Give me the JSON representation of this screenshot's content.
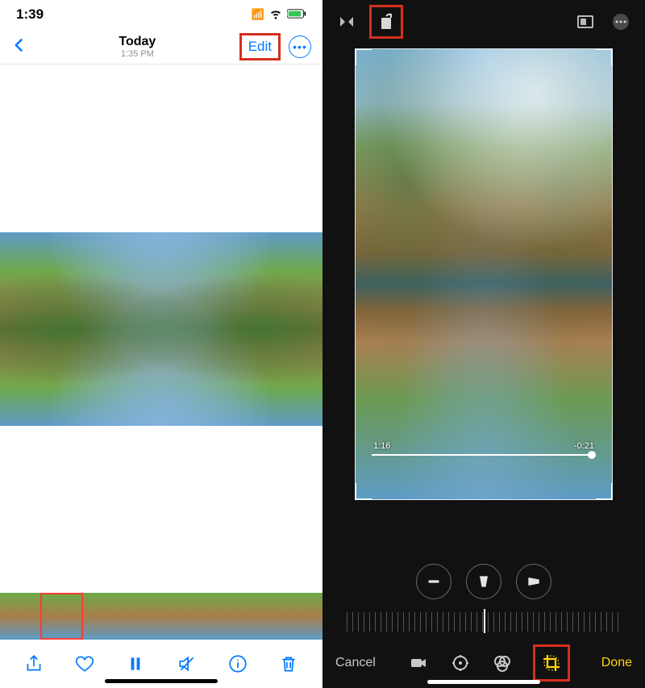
{
  "status": {
    "time": "1:39"
  },
  "nav": {
    "title": "Today",
    "subtitle": "1:35 PM",
    "edit_label": "Edit"
  },
  "viewer": {
    "toolbar": {
      "share": "share-icon",
      "favorite": "heart-icon",
      "play": "pause-icon",
      "mute": "mute-icon",
      "info": "info-icon",
      "trash": "trash-icon"
    }
  },
  "editor": {
    "top": {
      "flip": "flip-horizontal-icon",
      "rotate": "rotate-icon",
      "aspect": "aspect-ratio-icon",
      "more": "more-icon"
    },
    "scrubber": {
      "current": "1:16",
      "remaining": "-0:21"
    },
    "adjust": {
      "straighten": "straighten-icon",
      "vertical": "perspective-vertical-icon",
      "horizontal": "perspective-horizontal-icon"
    },
    "modes": {
      "video": "video-icon",
      "adjust": "adjust-icon",
      "filters": "filters-icon",
      "crop": "crop-icon"
    },
    "cancel_label": "Cancel",
    "done_label": "Done"
  }
}
